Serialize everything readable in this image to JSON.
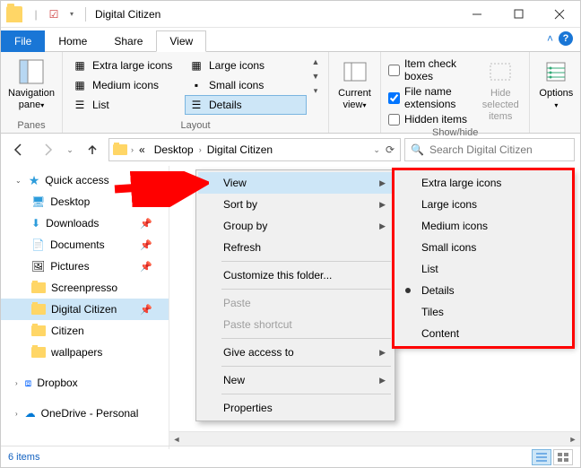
{
  "window": {
    "title": "Digital Citizen"
  },
  "tabs": {
    "file": "File",
    "home": "Home",
    "share": "Share",
    "view": "View"
  },
  "ribbon": {
    "panes": {
      "nav_pane": "Navigation pane",
      "group": "Panes"
    },
    "layout": {
      "extra_large": "Extra large icons",
      "large": "Large icons",
      "medium": "Medium icons",
      "small": "Small icons",
      "list": "List",
      "details": "Details",
      "group": "Layout"
    },
    "current_view": "Current view",
    "showhide": {
      "item_check": "Item check boxes",
      "file_ext": "File name extensions",
      "hidden": "Hidden items",
      "hide_selected": "Hide selected items",
      "group": "Show/hide"
    },
    "options": "Options"
  },
  "breadcrumbs": {
    "b1": "Desktop",
    "b2": "Digital Citizen"
  },
  "search": {
    "placeholder": "Search Digital Citizen"
  },
  "sidebar": {
    "quick_access": "Quick access",
    "desktop": "Desktop",
    "downloads": "Downloads",
    "documents": "Documents",
    "pictures": "Pictures",
    "screenpresso": "Screenpresso",
    "digital_citizen": "Digital Citizen",
    "citizen": "Citizen",
    "wallpapers": "wallpapers",
    "dropbox": "Dropbox",
    "onedrive": "OneDrive - Personal"
  },
  "context_menu": {
    "view": "View",
    "sort_by": "Sort by",
    "group_by": "Group by",
    "refresh": "Refresh",
    "customize": "Customize this folder...",
    "paste": "Paste",
    "paste_shortcut": "Paste shortcut",
    "give_access": "Give access to",
    "new": "New",
    "properties": "Properties"
  },
  "view_submenu": {
    "xl": "Extra large icons",
    "l": "Large icons",
    "m": "Medium icons",
    "s": "Small icons",
    "list": "List",
    "details": "Details",
    "tiles": "Tiles",
    "content": "Content"
  },
  "status": {
    "items": "6 items"
  }
}
